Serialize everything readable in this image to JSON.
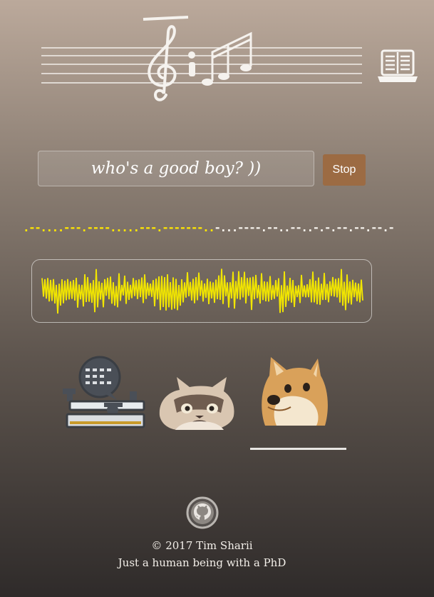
{
  "input": {
    "value": "who's a good boy? ))"
  },
  "controls": {
    "stop_label": "Stop"
  },
  "morse": {
    "played": ".--....---.----.....---.-------..",
    "pending": "-...----.--..--..-.-.--.--.--.-"
  },
  "colors": {
    "morse_played": "#ffe600",
    "stop_button": "#9c6b43",
    "waveform": "#f2e600"
  },
  "icons": {
    "logo": "music-staff-logo",
    "manual": "book-laptop-icon",
    "github": "github-icon"
  },
  "voices": [
    {
      "id": "telegraph",
      "icon": "telegraph-key-icon",
      "selected": false
    },
    {
      "id": "grumpy-cat",
      "icon": "grumpy-cat-icon",
      "selected": false
    },
    {
      "id": "doge",
      "icon": "doge-icon",
      "selected": true
    }
  ],
  "footer": {
    "copyright": "© 2017 Tim Sharii",
    "tagline": "Just a human being with a PhD"
  }
}
